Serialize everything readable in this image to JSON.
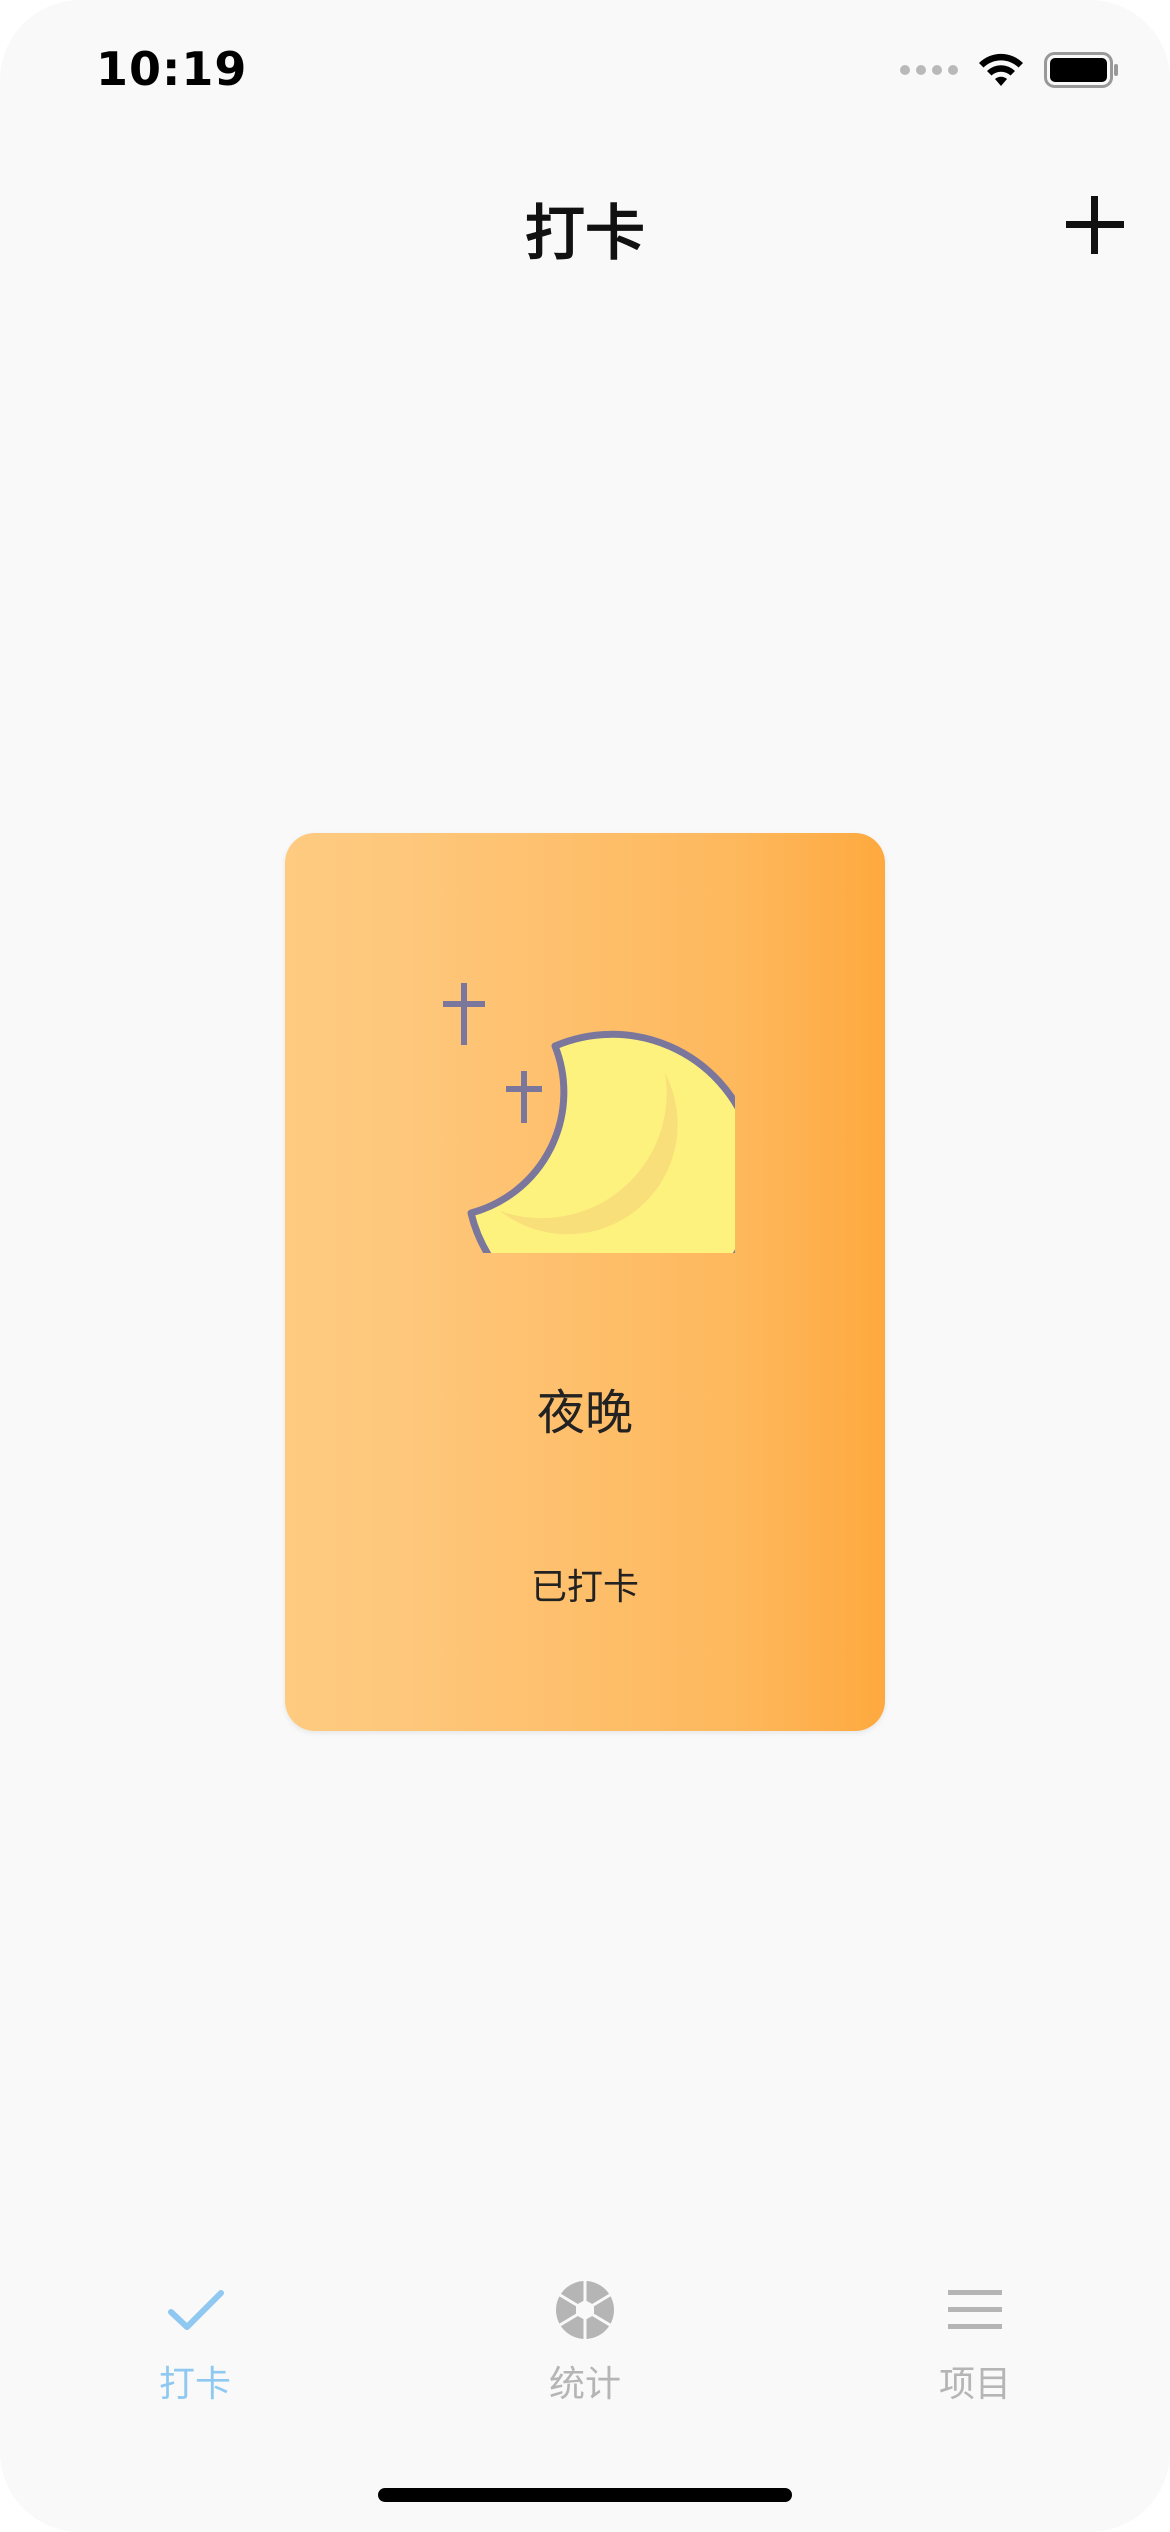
{
  "status_bar": {
    "time": "10:19"
  },
  "nav": {
    "title": "打卡"
  },
  "card": {
    "icon": "crescent-moon-icon",
    "name": "夜晚",
    "status": "已打卡"
  },
  "tabs": [
    {
      "label": "打卡",
      "icon": "checkmark-icon",
      "active": true
    },
    {
      "label": "统计",
      "icon": "aperture-icon",
      "active": false
    },
    {
      "label": "项目",
      "icon": "list-icon",
      "active": false
    }
  ],
  "colors": {
    "background": "#f9f9f9",
    "card_gradient_start": "#fecb81",
    "card_gradient_end": "#fea93f",
    "moon_fill": "#fef27e",
    "moon_stroke": "#7a769c",
    "tab_active": "#8fc8f0",
    "tab_inactive": "#b5b5b5"
  }
}
